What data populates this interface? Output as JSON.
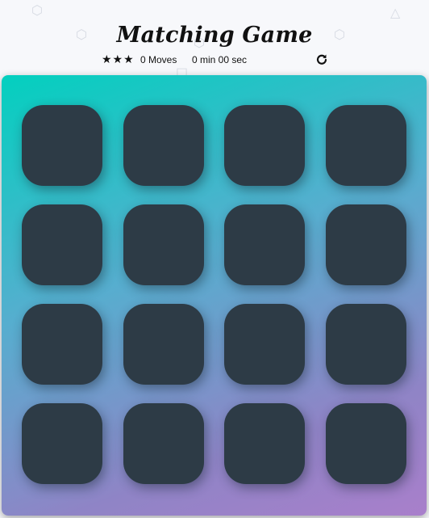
{
  "title": "Matching Game",
  "score_panel": {
    "stars": "★★★",
    "moves": "0 Moves",
    "timer": "0 min 00 sec",
    "restart_icon": "⟳"
  },
  "deck": {
    "cards": [
      {},
      {},
      {},
      {},
      {},
      {},
      {},
      {},
      {},
      {},
      {},
      {},
      {},
      {},
      {},
      {}
    ]
  },
  "background_shapes": [
    "⬡",
    "⬡",
    "△",
    "⬡",
    "⬡",
    "□"
  ],
  "colors": {
    "card_back": "#2d3b46",
    "deck_gradient_start": "#03d0bf",
    "deck_gradient_end": "#a97fcb"
  }
}
